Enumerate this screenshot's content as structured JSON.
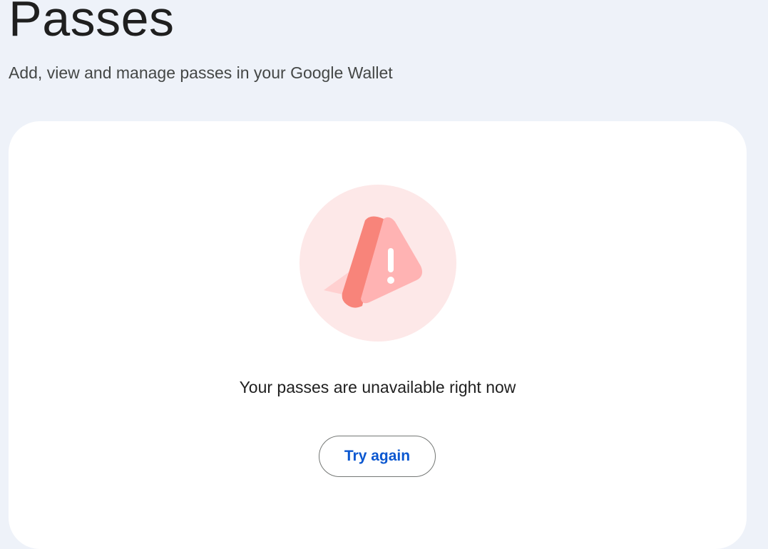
{
  "header": {
    "title": "Passes",
    "subtitle": "Add, view and manage passes in your Google Wallet"
  },
  "error_card": {
    "icon": "warning-triangle-icon",
    "message": "Your passes are unavailable right now",
    "retry_label": "Try again"
  },
  "colors": {
    "background": "#eef2f9",
    "card": "#ffffff",
    "icon_circle": "#fde8e8",
    "icon_triangle_front": "#ffb3b3",
    "icon_triangle_side": "#f8847a",
    "accent_link": "#0b57d0"
  }
}
